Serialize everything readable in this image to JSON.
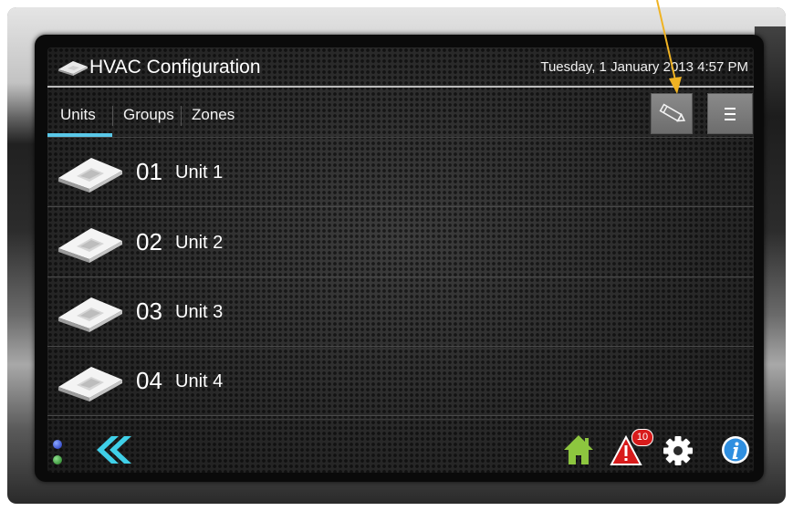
{
  "header": {
    "title": "HVAC Configuration",
    "datetime": "Tuesday, 1 January 2013 4:57 PM",
    "app_icon": "ceiling-cassette-unit-icon"
  },
  "tabs": [
    {
      "label": "Units",
      "active": true
    },
    {
      "label": "Groups",
      "active": false
    },
    {
      "label": "Zones",
      "active": false
    }
  ],
  "toolbar": {
    "edit_icon": "pencil-icon",
    "menu_icon": "hamburger-menu-icon"
  },
  "units": [
    {
      "number": "01",
      "name": "Unit 1",
      "icon": "ceiling-cassette-unit-icon"
    },
    {
      "number": "02",
      "name": "Unit 2",
      "icon": "ceiling-cassette-unit-icon"
    },
    {
      "number": "03",
      "name": "Unit 3",
      "icon": "ceiling-cassette-unit-icon"
    },
    {
      "number": "04",
      "name": "Unit 4",
      "icon": "ceiling-cassette-unit-icon"
    }
  ],
  "footer": {
    "back_icon": "double-chevron-left-icon",
    "home_icon": "home-icon",
    "alarm_icon": "warning-triangle-icon",
    "alarm_count": "10",
    "settings_icon": "gear-icon",
    "info_icon": "info-icon"
  },
  "colors": {
    "accent": "#5ac8e8",
    "home": "#8dc63f",
    "alarm": "#d81b1b",
    "info": "#2f8fe0",
    "annotation_arrow": "#f0b323"
  }
}
